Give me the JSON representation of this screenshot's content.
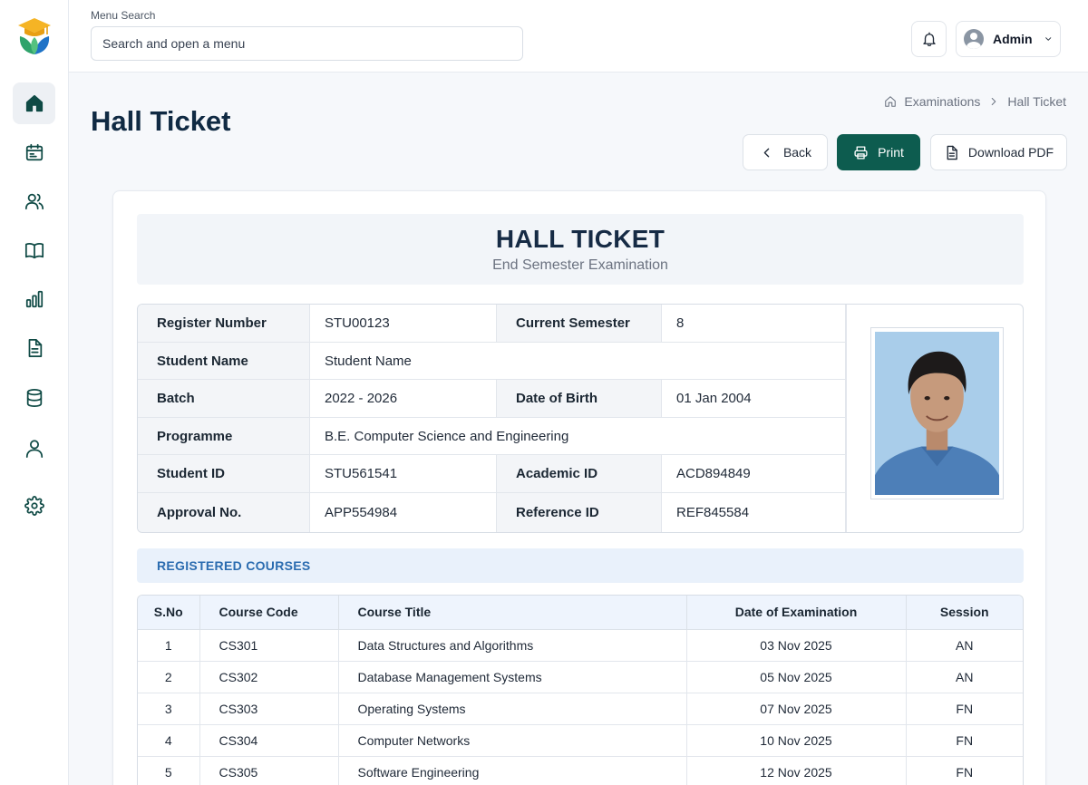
{
  "search": {
    "label": "Menu Search",
    "placeholder": "Search and open a menu"
  },
  "user": {
    "name": "Admin"
  },
  "breadcrumb": {
    "parent": "Examinations",
    "current": "Hall Ticket"
  },
  "page": {
    "title": "Hall Ticket"
  },
  "actions": {
    "back": "Back",
    "print": "Print",
    "download": "Download PDF"
  },
  "nav": [
    "home-icon",
    "calendar-icon",
    "users-icon",
    "book-icon",
    "bar-chart-icon",
    "document-icon",
    "database-icon",
    "user-icon",
    "gear-icon"
  ],
  "ticket": {
    "title": "HALL TICKET",
    "subtitle": "End Semester Examination"
  },
  "student": {
    "register_number_label": "Register Number",
    "register_number": "STU00123",
    "current_semester_label": "Current Semester",
    "current_semester": "8",
    "name_label": "Student Name",
    "name": "Student Name",
    "batch_label": "Batch",
    "batch": "2022 - 2026",
    "dob_label": "Date of Birth",
    "dob": "01 Jan 2004",
    "programme_label": "Programme",
    "programme": "B.E. Computer Science and Engineering",
    "student_id_label": "Student ID",
    "student_id": "STU561541",
    "academic_id_label": "Academic ID",
    "academic_id": "ACD894849",
    "approval_label": "Approval No.",
    "approval": "APP554984",
    "reference_label": "Reference ID",
    "reference": "REF845584"
  },
  "courses": {
    "section_title": "REGISTERED COURSES",
    "headers": [
      "S.No",
      "Course Code",
      "Course Title",
      "Date of Examination",
      "Session"
    ],
    "rows": [
      [
        "1",
        "CS301",
        "Data Structures and Algorithms",
        "03 Nov 2025",
        "AN"
      ],
      [
        "2",
        "CS302",
        "Database Management Systems",
        "05 Nov 2025",
        "AN"
      ],
      [
        "3",
        "CS303",
        "Operating Systems",
        "07 Nov 2025",
        "FN"
      ],
      [
        "4",
        "CS304",
        "Computer Networks",
        "10 Nov 2025",
        "FN"
      ],
      [
        "5",
        "CS305",
        "Software Engineering",
        "12 Nov 2025",
        "FN"
      ]
    ]
  },
  "colors": {
    "primary": "#0d5c4f",
    "accent_blue": "#2b6cb0",
    "title": "#102a43"
  }
}
